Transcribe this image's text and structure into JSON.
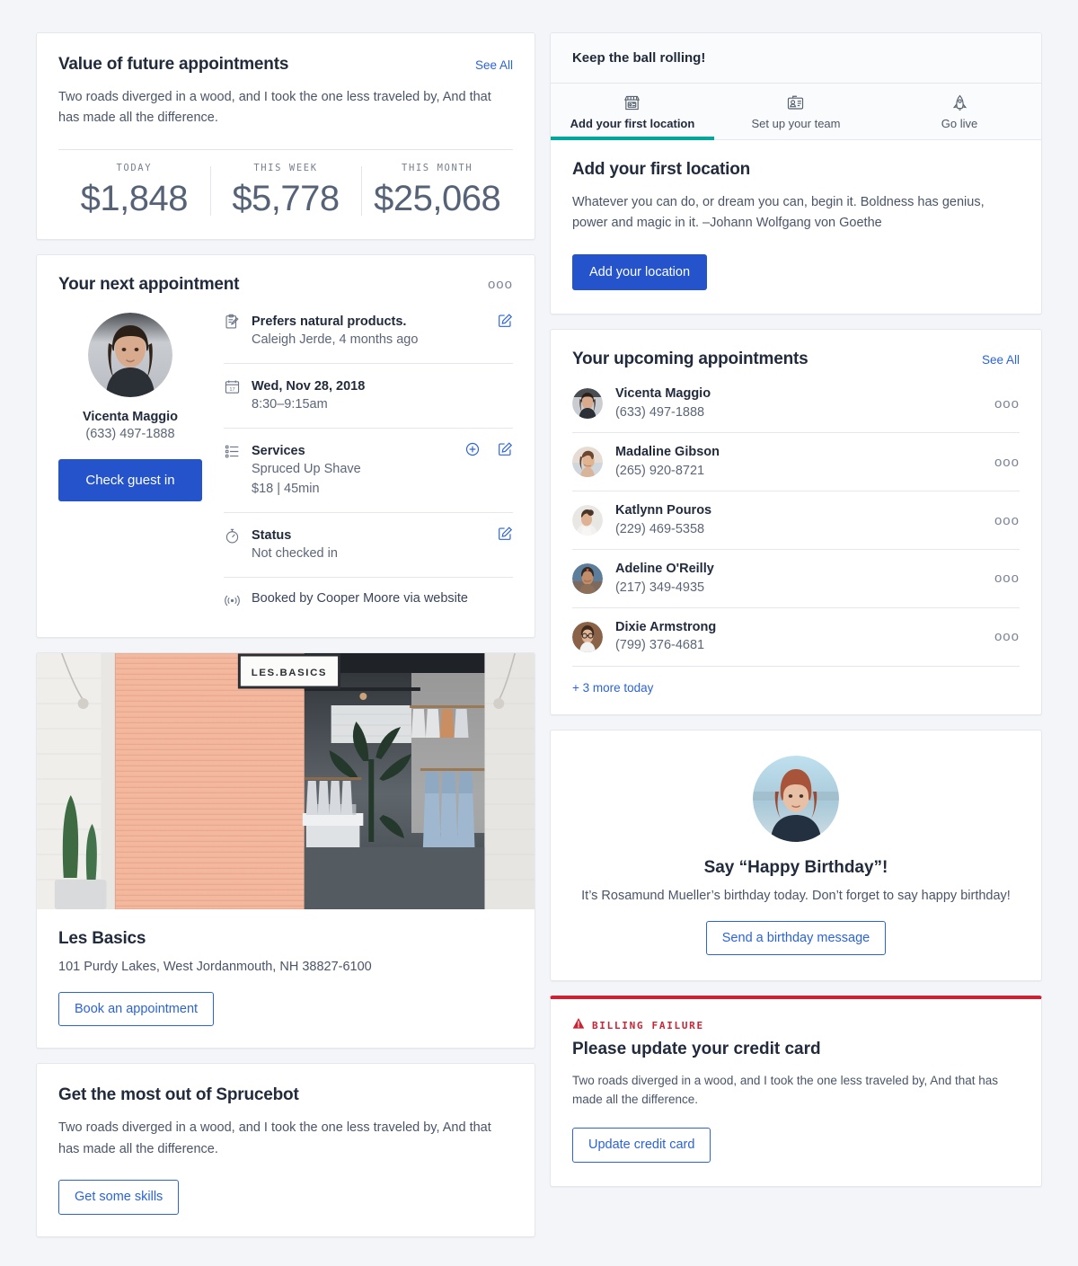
{
  "value_card": {
    "title": "Value of future appointments",
    "see_all": "See All",
    "description": "Two roads diverged in a wood, and I took the one less traveled by, And that has made all the difference.",
    "stats": [
      {
        "label": "TODAY",
        "value": "$1,848"
      },
      {
        "label": "THIS WEEK",
        "value": "$5,778"
      },
      {
        "label": "THIS MONTH",
        "value": "$25,068"
      }
    ]
  },
  "next_appointment": {
    "title": "Your next appointment",
    "menu_icon": "ooo",
    "guest_name": "Vicenta Maggio",
    "guest_phone": "(633) 497-1888",
    "check_in_label": "Check guest in",
    "rows": [
      {
        "icon": "clipboard-pencil-icon",
        "primary": "Prefers natural products.",
        "secondary": "Caleigh Jerde, 4 months ago"
      },
      {
        "icon": "calendar-icon",
        "primary": "Wed, Nov 28, 2018",
        "secondary": "8:30–9:15am"
      },
      {
        "icon": "list-icon",
        "primary": "Services",
        "secondary": "Spruced Up Shave",
        "tertiary": "$18 | 45min"
      },
      {
        "icon": "stopwatch-icon",
        "primary": "Status",
        "secondary": "Not checked in"
      }
    ],
    "booked_by": "Booked by Cooper Moore via website"
  },
  "storefront": {
    "sign_text": "LES.BASICS",
    "name": "Les Basics",
    "address": "101 Purdy Lakes, West Jordanmouth, NH 38827-6100",
    "book_label": "Book an appointment"
  },
  "sprucebot": {
    "title": "Get the most out of Sprucebot",
    "description": "Two roads diverged in a wood, and I took the one less traveled by, And that has made all the difference.",
    "button_label": "Get some skills"
  },
  "keep_rolling": {
    "header": "Keep the ball rolling!",
    "tabs": [
      {
        "label": "Add your first location",
        "icon": "storefront-icon",
        "active": true
      },
      {
        "label": "Set up your team",
        "icon": "id-badge-icon",
        "active": false
      },
      {
        "label": "Go live",
        "icon": "rocket-icon",
        "active": false
      }
    ],
    "panel_title": "Add your first location",
    "panel_text": "Whatever you can do, or dream you can, begin it. Boldness has genius, power and magic in it. –Johann Wolfgang von Goethe",
    "panel_button": "Add your location"
  },
  "upcoming": {
    "title": "Your upcoming appointments",
    "see_all": "See All",
    "more_link": "+ 3 more today",
    "people": [
      {
        "name": "Vicenta Maggio",
        "phone": "(633) 497-1888",
        "menu": "ooo"
      },
      {
        "name": "Madaline Gibson",
        "phone": "(265) 920-8721",
        "menu": "ooo"
      },
      {
        "name": "Katlynn Pouros",
        "phone": "(229) 469-5358",
        "menu": "ooo"
      },
      {
        "name": "Adeline O'Reilly",
        "phone": "(217) 349-4935",
        "menu": "ooo"
      },
      {
        "name": "Dixie Armstrong",
        "phone": "(799) 376-4681",
        "menu": "ooo"
      }
    ]
  },
  "birthday": {
    "title": "Say “Happy Birthday”!",
    "text": "It’s Rosamund Mueller’s birthday today. Don’t forget to say happy birthday!",
    "button_label": "Send a birthday message"
  },
  "billing": {
    "tag": "BILLING FAILURE",
    "title": "Please update your credit card",
    "text": "Two roads diverged in a wood, and I took the one less traveled by, And that has made all the difference.",
    "button_label": "Update credit card"
  },
  "colors": {
    "accent_blue": "#2453cc",
    "link_blue": "#2b63d9",
    "teal": "#00a79d",
    "danger_red": "#cc2233",
    "page_bg": "#f4f5f8"
  }
}
